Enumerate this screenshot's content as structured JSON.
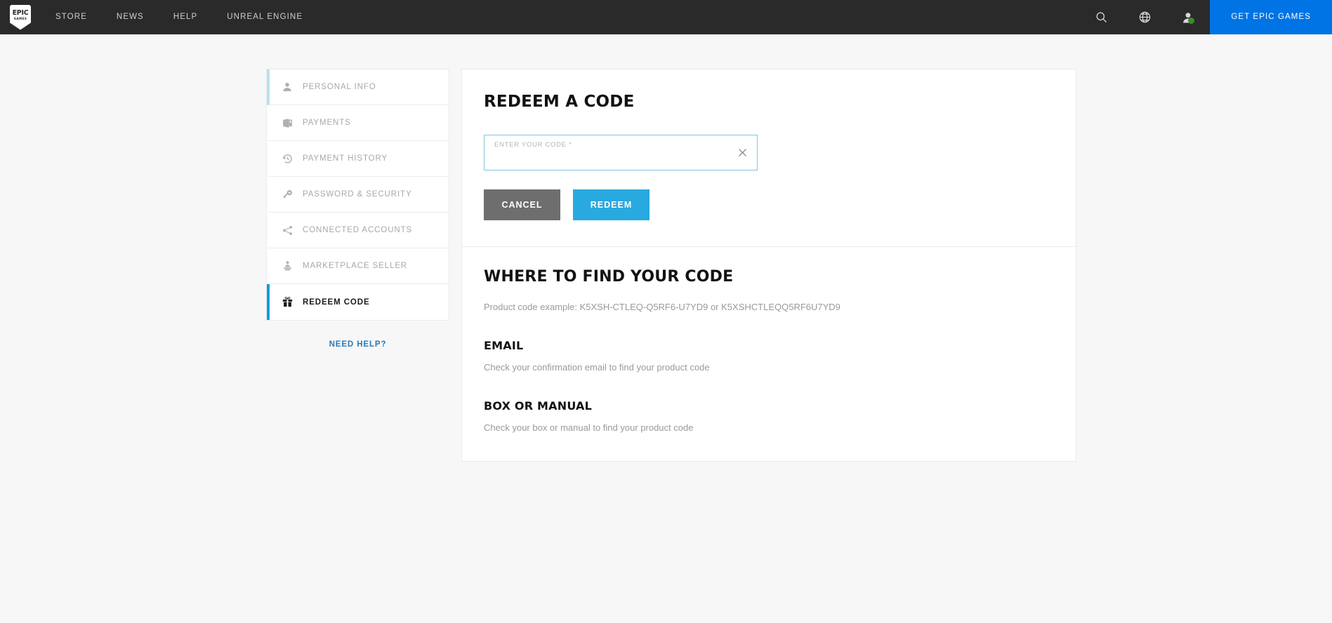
{
  "header": {
    "logo": {
      "line1": "EPIC",
      "line2": "GAMES",
      "icon": "epic-games-shield-logo"
    },
    "nav": [
      {
        "label": "STORE",
        "icon": "none"
      },
      {
        "label": "NEWS",
        "icon": "none"
      },
      {
        "label": "HELP",
        "icon": "none"
      },
      {
        "label": "UNREAL ENGINE",
        "icon": "none"
      }
    ],
    "icons": [
      {
        "name": "search-icon"
      },
      {
        "name": "globe-icon"
      },
      {
        "name": "account-avatar-icon"
      }
    ],
    "cta_label": "GET EPIC GAMES",
    "background_color": "#2a2a2a",
    "cta_color": "#0074e4",
    "status_dot_color": "#3c8a2e"
  },
  "sidebar": {
    "items": [
      {
        "label": "PERSONAL INFO",
        "icon": "person-icon",
        "active": false
      },
      {
        "label": "PAYMENTS",
        "icon": "wallet-icon",
        "active": false
      },
      {
        "label": "PAYMENT HISTORY",
        "icon": "history-clock-icon",
        "active": false
      },
      {
        "label": "PASSWORD & SECURITY",
        "icon": "key-icon",
        "active": false
      },
      {
        "label": "CONNECTED ACCOUNTS",
        "icon": "share-nodes-icon",
        "active": false
      },
      {
        "label": "MARKETPLACE SELLER",
        "icon": "seller-podium-icon",
        "active": false
      },
      {
        "label": "REDEEM CODE",
        "icon": "gift-icon",
        "active": true
      }
    ],
    "need_help_label": "NEED HELP?",
    "active_accent_color": "#0f9ce0",
    "first_accent_color": "#b9e1f2",
    "link_color": "#2b7ab5"
  },
  "main": {
    "title": "REDEEM A CODE",
    "input": {
      "label": "ENTER YOUR CODE *",
      "value": "",
      "placeholder": "",
      "clear_icon": "close-x-icon",
      "border_color": "#7fc4dd"
    },
    "buttons": {
      "cancel_label": "CANCEL",
      "redeem_label": "REDEEM",
      "cancel_color": "#6e6e6e",
      "redeem_color": "#28a9e0"
    },
    "find_section": {
      "title": "WHERE TO FIND YOUR CODE",
      "code_example": "Product code example: K5XSH-CTLEQ-Q5RF6-U7YD9 or K5XSHCTLEQQ5RF6U7YD9",
      "blocks": [
        {
          "title": "EMAIL",
          "body": "Check your confirmation email to find your product code"
        },
        {
          "title": "BOX OR MANUAL",
          "body": "Check your box or manual to find your product code"
        }
      ]
    }
  }
}
